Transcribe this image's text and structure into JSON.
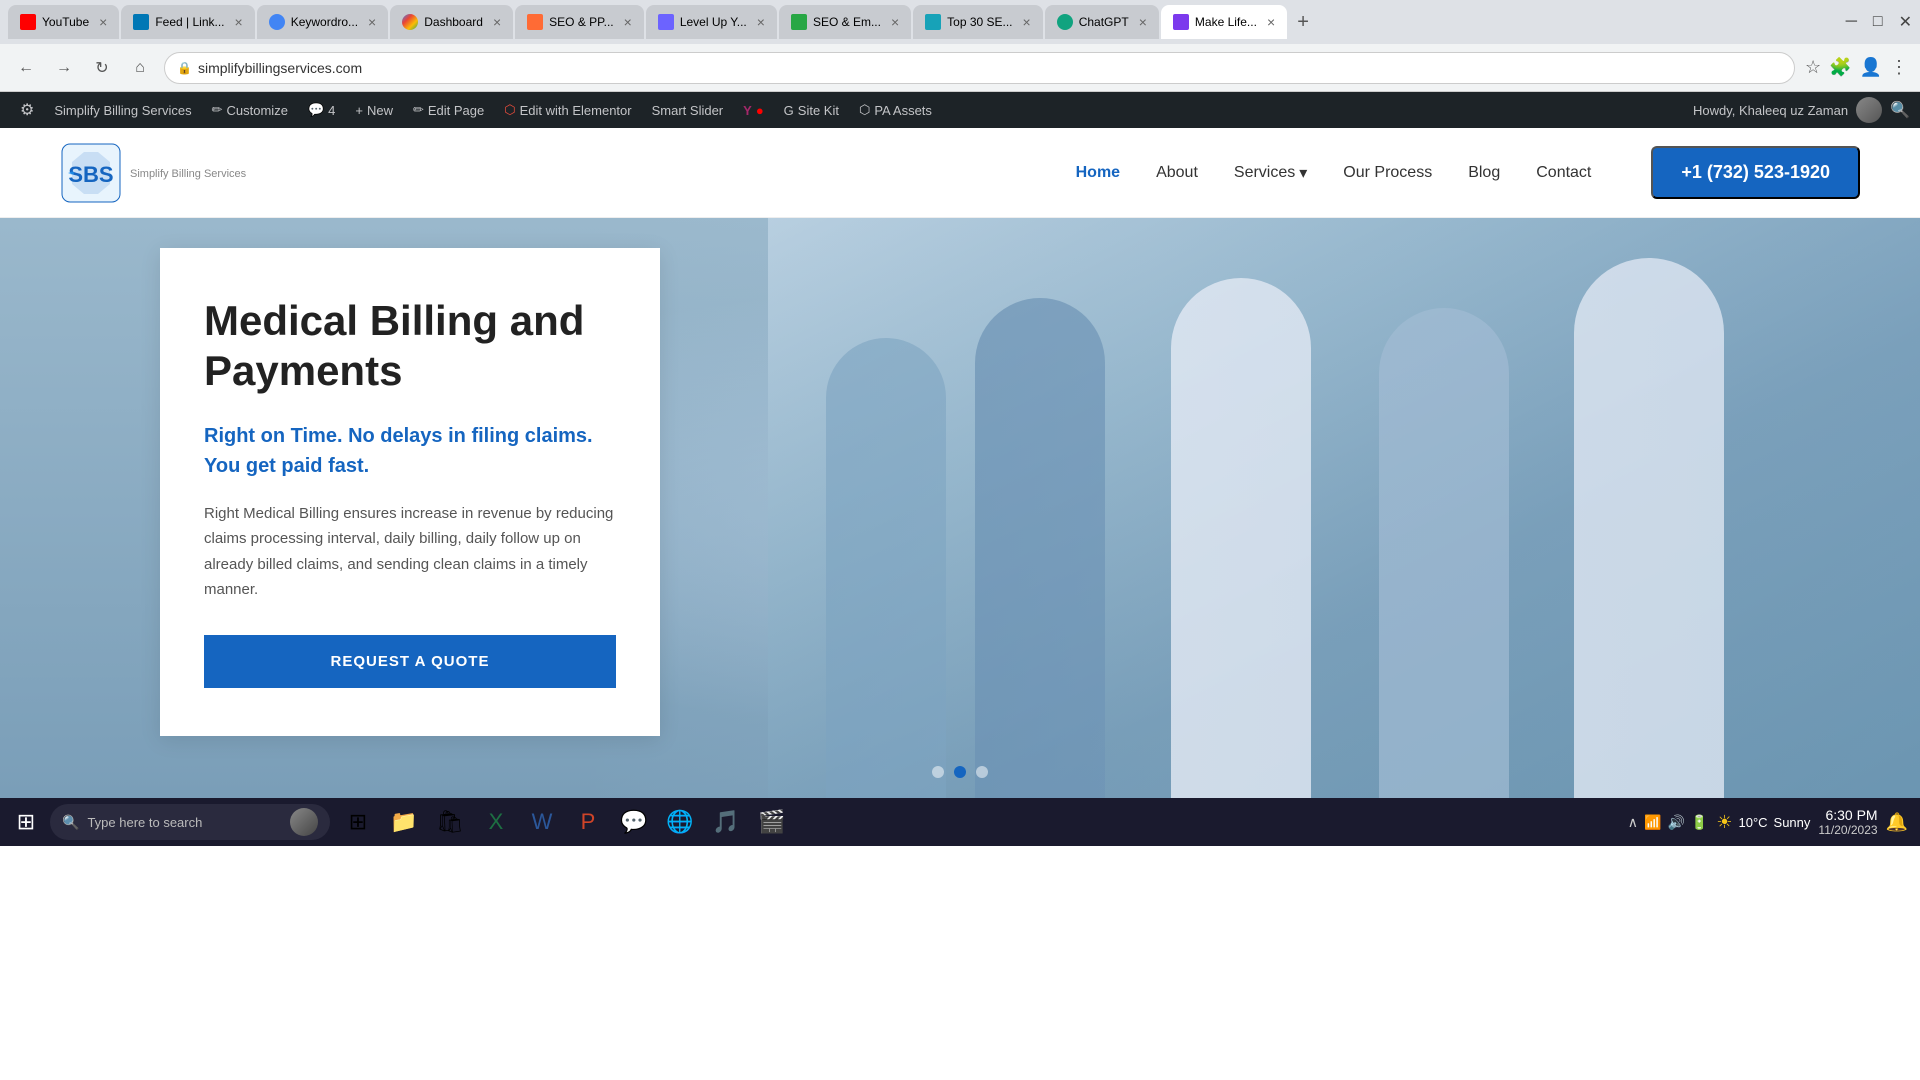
{
  "browser": {
    "tabs": [
      {
        "id": "youtube",
        "title": "YouTube",
        "favicon_type": "yt-favicon",
        "active": false
      },
      {
        "id": "linkedin",
        "title": "Feed | Link...",
        "favicon_type": "li-favicon",
        "active": false
      },
      {
        "id": "keyword",
        "title": "Keywordro...",
        "favicon_type": "c-favicon",
        "active": false
      },
      {
        "id": "dashboard",
        "title": "Dashboard",
        "favicon_type": "g-favicon",
        "active": false
      },
      {
        "id": "seo1",
        "title": "SEO & PP...",
        "favicon_type": "seo-favicon",
        "active": false
      },
      {
        "id": "levelup",
        "title": "Level Up Y...",
        "favicon_type": "lv-favicon",
        "active": false
      },
      {
        "id": "seo2",
        "title": "SEO & Em...",
        "favicon_type": "seo2-favicon",
        "active": false
      },
      {
        "id": "top30",
        "title": "Top 30 SE...",
        "favicon_type": "top-favicon",
        "active": false
      },
      {
        "id": "chatgpt",
        "title": "ChatGPT",
        "favicon_type": "chatgpt-favicon",
        "active": false
      },
      {
        "id": "makelife",
        "title": "Make Life...",
        "favicon_type": "make-favicon",
        "active": true
      }
    ],
    "url": "simplifybillingservices.com",
    "window_controls": {
      "minimize": "─",
      "maximize": "□",
      "close": "✕"
    }
  },
  "wordpress_bar": {
    "items": [
      {
        "label": "W",
        "icon": true
      },
      {
        "label": "Simplify Billing Services"
      },
      {
        "label": "Customize"
      },
      {
        "label": "4"
      },
      {
        "label": "New"
      },
      {
        "label": "Edit Page"
      },
      {
        "label": "Edit with Elementor"
      },
      {
        "label": "Smart Slider"
      },
      {
        "label": "Y"
      },
      {
        "label": "●"
      },
      {
        "label": "Site Kit"
      },
      {
        "label": "PA Assets"
      }
    ],
    "howdy": "Howdy, Khaleeq uz Zaman"
  },
  "site_nav": {
    "logo_letters": "SBS",
    "logo_company": "Simplify Billing Services",
    "nav_links": [
      {
        "label": "Home",
        "active": true
      },
      {
        "label": "About",
        "active": false
      },
      {
        "label": "Services",
        "has_dropdown": true,
        "active": false
      },
      {
        "label": "Our Process",
        "active": false
      },
      {
        "label": "Blog",
        "active": false
      },
      {
        "label": "Contact",
        "active": false
      }
    ],
    "phone": "+1 (732) 523-1920"
  },
  "hero": {
    "title": "Medical Billing and Payments",
    "subtitle_line1": "Right on Time. No delays in filing claims.",
    "subtitle_line2": "You get paid fast.",
    "description": "Right Medical Billing ensures increase in revenue by reducing claims processing interval, daily billing, daily follow up on already billed claims, and sending clean claims in a timely manner.",
    "cta_label": "REQUEST A QUOTE",
    "slider_dots": [
      {
        "active": false
      },
      {
        "active": true
      },
      {
        "active": false
      }
    ]
  },
  "taskbar": {
    "search_placeholder": "Type here to search",
    "apps": [
      {
        "name": "task-view",
        "icon": "⊞"
      },
      {
        "name": "file-explorer",
        "icon": "📁"
      },
      {
        "name": "store",
        "icon": "🛍"
      },
      {
        "name": "excel",
        "icon": "📊"
      },
      {
        "name": "word",
        "icon": "📝"
      },
      {
        "name": "powerpoint",
        "icon": "📑"
      },
      {
        "name": "whatsapp",
        "icon": "💬"
      },
      {
        "name": "chrome",
        "icon": "🌐"
      },
      {
        "name": "media",
        "icon": "🎵"
      },
      {
        "name": "davinci",
        "icon": "🎬"
      }
    ],
    "weather_temp": "10°C",
    "weather_condition": "Sunny",
    "time": "6:30 PM",
    "date": "11/20/2023"
  }
}
